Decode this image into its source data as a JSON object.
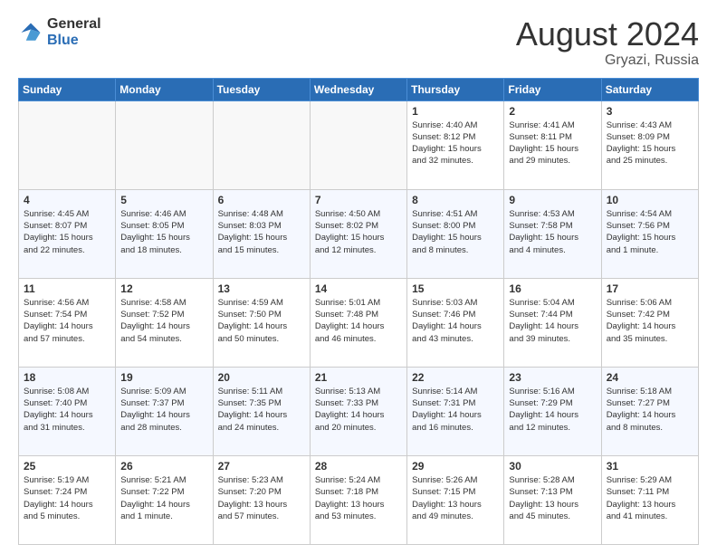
{
  "header": {
    "logo_general": "General",
    "logo_blue": "Blue",
    "month_year": "August 2024",
    "location": "Gryazi, Russia"
  },
  "days_of_week": [
    "Sunday",
    "Monday",
    "Tuesday",
    "Wednesday",
    "Thursday",
    "Friday",
    "Saturday"
  ],
  "weeks": [
    [
      {
        "day": "",
        "info": ""
      },
      {
        "day": "",
        "info": ""
      },
      {
        "day": "",
        "info": ""
      },
      {
        "day": "",
        "info": ""
      },
      {
        "day": "1",
        "info": "Sunrise: 4:40 AM\nSunset: 8:12 PM\nDaylight: 15 hours\nand 32 minutes."
      },
      {
        "day": "2",
        "info": "Sunrise: 4:41 AM\nSunset: 8:11 PM\nDaylight: 15 hours\nand 29 minutes."
      },
      {
        "day": "3",
        "info": "Sunrise: 4:43 AM\nSunset: 8:09 PM\nDaylight: 15 hours\nand 25 minutes."
      }
    ],
    [
      {
        "day": "4",
        "info": "Sunrise: 4:45 AM\nSunset: 8:07 PM\nDaylight: 15 hours\nand 22 minutes."
      },
      {
        "day": "5",
        "info": "Sunrise: 4:46 AM\nSunset: 8:05 PM\nDaylight: 15 hours\nand 18 minutes."
      },
      {
        "day": "6",
        "info": "Sunrise: 4:48 AM\nSunset: 8:03 PM\nDaylight: 15 hours\nand 15 minutes."
      },
      {
        "day": "7",
        "info": "Sunrise: 4:50 AM\nSunset: 8:02 PM\nDaylight: 15 hours\nand 12 minutes."
      },
      {
        "day": "8",
        "info": "Sunrise: 4:51 AM\nSunset: 8:00 PM\nDaylight: 15 hours\nand 8 minutes."
      },
      {
        "day": "9",
        "info": "Sunrise: 4:53 AM\nSunset: 7:58 PM\nDaylight: 15 hours\nand 4 minutes."
      },
      {
        "day": "10",
        "info": "Sunrise: 4:54 AM\nSunset: 7:56 PM\nDaylight: 15 hours\nand 1 minute."
      }
    ],
    [
      {
        "day": "11",
        "info": "Sunrise: 4:56 AM\nSunset: 7:54 PM\nDaylight: 14 hours\nand 57 minutes."
      },
      {
        "day": "12",
        "info": "Sunrise: 4:58 AM\nSunset: 7:52 PM\nDaylight: 14 hours\nand 54 minutes."
      },
      {
        "day": "13",
        "info": "Sunrise: 4:59 AM\nSunset: 7:50 PM\nDaylight: 14 hours\nand 50 minutes."
      },
      {
        "day": "14",
        "info": "Sunrise: 5:01 AM\nSunset: 7:48 PM\nDaylight: 14 hours\nand 46 minutes."
      },
      {
        "day": "15",
        "info": "Sunrise: 5:03 AM\nSunset: 7:46 PM\nDaylight: 14 hours\nand 43 minutes."
      },
      {
        "day": "16",
        "info": "Sunrise: 5:04 AM\nSunset: 7:44 PM\nDaylight: 14 hours\nand 39 minutes."
      },
      {
        "day": "17",
        "info": "Sunrise: 5:06 AM\nSunset: 7:42 PM\nDaylight: 14 hours\nand 35 minutes."
      }
    ],
    [
      {
        "day": "18",
        "info": "Sunrise: 5:08 AM\nSunset: 7:40 PM\nDaylight: 14 hours\nand 31 minutes."
      },
      {
        "day": "19",
        "info": "Sunrise: 5:09 AM\nSunset: 7:37 PM\nDaylight: 14 hours\nand 28 minutes."
      },
      {
        "day": "20",
        "info": "Sunrise: 5:11 AM\nSunset: 7:35 PM\nDaylight: 14 hours\nand 24 minutes."
      },
      {
        "day": "21",
        "info": "Sunrise: 5:13 AM\nSunset: 7:33 PM\nDaylight: 14 hours\nand 20 minutes."
      },
      {
        "day": "22",
        "info": "Sunrise: 5:14 AM\nSunset: 7:31 PM\nDaylight: 14 hours\nand 16 minutes."
      },
      {
        "day": "23",
        "info": "Sunrise: 5:16 AM\nSunset: 7:29 PM\nDaylight: 14 hours\nand 12 minutes."
      },
      {
        "day": "24",
        "info": "Sunrise: 5:18 AM\nSunset: 7:27 PM\nDaylight: 14 hours\nand 8 minutes."
      }
    ],
    [
      {
        "day": "25",
        "info": "Sunrise: 5:19 AM\nSunset: 7:24 PM\nDaylight: 14 hours\nand 5 minutes."
      },
      {
        "day": "26",
        "info": "Sunrise: 5:21 AM\nSunset: 7:22 PM\nDaylight: 14 hours\nand 1 minute."
      },
      {
        "day": "27",
        "info": "Sunrise: 5:23 AM\nSunset: 7:20 PM\nDaylight: 13 hours\nand 57 minutes."
      },
      {
        "day": "28",
        "info": "Sunrise: 5:24 AM\nSunset: 7:18 PM\nDaylight: 13 hours\nand 53 minutes."
      },
      {
        "day": "29",
        "info": "Sunrise: 5:26 AM\nSunset: 7:15 PM\nDaylight: 13 hours\nand 49 minutes."
      },
      {
        "day": "30",
        "info": "Sunrise: 5:28 AM\nSunset: 7:13 PM\nDaylight: 13 hours\nand 45 minutes."
      },
      {
        "day": "31",
        "info": "Sunrise: 5:29 AM\nSunset: 7:11 PM\nDaylight: 13 hours\nand 41 minutes."
      }
    ]
  ]
}
